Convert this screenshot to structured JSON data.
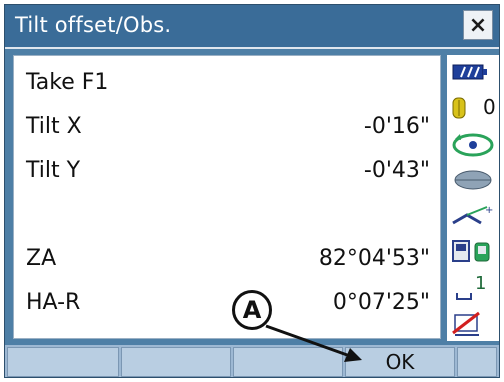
{
  "window": {
    "title": "Tilt offset/Obs.",
    "close_label": "×"
  },
  "rows": [
    {
      "label": "Take F1",
      "value": ""
    },
    {
      "label": "Tilt X",
      "value": "-0'16\""
    },
    {
      "label": "Tilt Y",
      "value": "-0'43\""
    },
    {
      "label": "",
      "value": ""
    },
    {
      "label": "ZA",
      "value": "82°04'53\""
    },
    {
      "label": "HA-R",
      "value": "0°07'25\""
    }
  ],
  "status": {
    "icons": [
      "battery-icon",
      "target-icon",
      "tilt-icon",
      "prism-icon",
      "laser-icon",
      "device-icon",
      "input-mode-icon",
      "edit-disabled-icon"
    ],
    "target_constant": "0",
    "input_mode_digit": "1"
  },
  "softkeys": [
    "",
    "",
    "",
    "OK",
    ""
  ],
  "callout": {
    "label": "A"
  },
  "colors": {
    "title_bar": "#3a6c98",
    "frame": "#4e7fa6",
    "softkey_bar": "#9db8d3",
    "content_bg": "#ffffff"
  }
}
